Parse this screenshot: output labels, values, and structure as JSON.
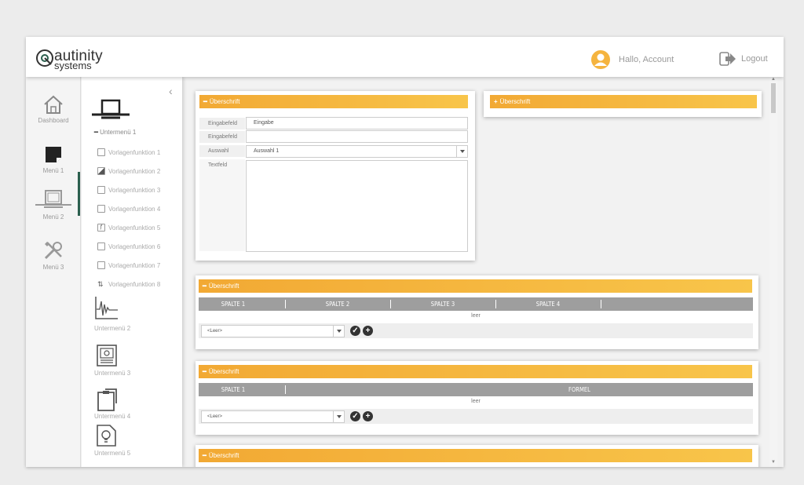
{
  "brand": {
    "name_top": "autinity",
    "name_bottom": "systems",
    "accent": "#f5b43f",
    "dark_green": "#2b5f4e"
  },
  "header": {
    "greeting": "Hallo, Account",
    "logout": "Logout"
  },
  "nav": {
    "items": [
      {
        "label": "Dashboard",
        "icon": "home-icon"
      },
      {
        "label": "Menü 1",
        "icon": "note-icon",
        "active": true
      },
      {
        "label": "Menü 2",
        "icon": "monitor-icon"
      },
      {
        "label": "Menü 3",
        "icon": "tools-icon"
      }
    ]
  },
  "submenu": {
    "active_title": "Untermenü 1",
    "functions": [
      "Vorlagenfunktion 1",
      "Vorlagenfunktion 2",
      "Vorlagenfunktion 3",
      "Vorlagenfunktion 4",
      "Vorlagenfunktion 5",
      "Vorlagenfunktion 6",
      "Vorlagenfunktion 7",
      "Vorlagenfunktion 8"
    ],
    "others": [
      "Untermenü 2",
      "Untermenü 3",
      "Untermenü 4",
      "Untermenü 5"
    ]
  },
  "panels": {
    "form": {
      "title": "Überschrift",
      "fields": [
        {
          "label": "Eingabefeld",
          "value": "Eingabe"
        },
        {
          "label": "Eingabefeld",
          "value": ""
        },
        {
          "label": "Auswahl",
          "value": "Auswahl 1"
        },
        {
          "label": "Textfeld",
          "value": ""
        }
      ]
    },
    "collapsed": {
      "title": "Überschrift"
    },
    "table1": {
      "title": "Überschrift",
      "columns": [
        "SPALTE 1",
        "SPALTE 2",
        "SPALTE 3",
        "SPALTE 4"
      ],
      "empty": "leer",
      "select": "<Leer>"
    },
    "table2": {
      "title": "Überschrift",
      "columns": [
        "SPALTE 1",
        "FORMEL"
      ],
      "empty": "leer",
      "select": "<Leer>"
    },
    "table3": {
      "title": "Überschrift"
    }
  }
}
